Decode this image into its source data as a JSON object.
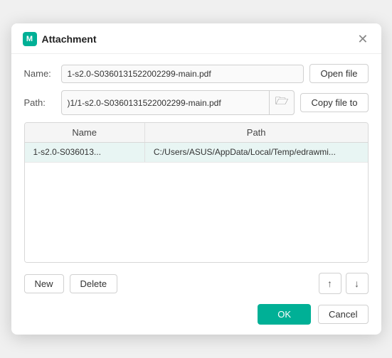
{
  "dialog": {
    "title": "Attachment",
    "app_icon_label": "M"
  },
  "fields": {
    "name_label": "Name:",
    "name_value": "1-s2.0-S0360131522002299-main.pdf",
    "path_label": "Path:",
    "path_value": ")1/1-s2.0-S0360131522002299-main.pdf",
    "open_file_label": "Open file",
    "copy_file_to_label": "Copy file to"
  },
  "table": {
    "col_name": "Name",
    "col_path": "Path",
    "rows": [
      {
        "name": "1-s2.0-S036013...",
        "path": "C:/Users/ASUS/AppData/Local/Temp/edrawmi..."
      }
    ]
  },
  "footer": {
    "new_label": "New",
    "delete_label": "Delete",
    "up_arrow": "↑",
    "down_arrow": "↓"
  },
  "actions": {
    "ok_label": "OK",
    "cancel_label": "Cancel"
  },
  "icons": {
    "folder": "🗁",
    "close": "✕"
  }
}
